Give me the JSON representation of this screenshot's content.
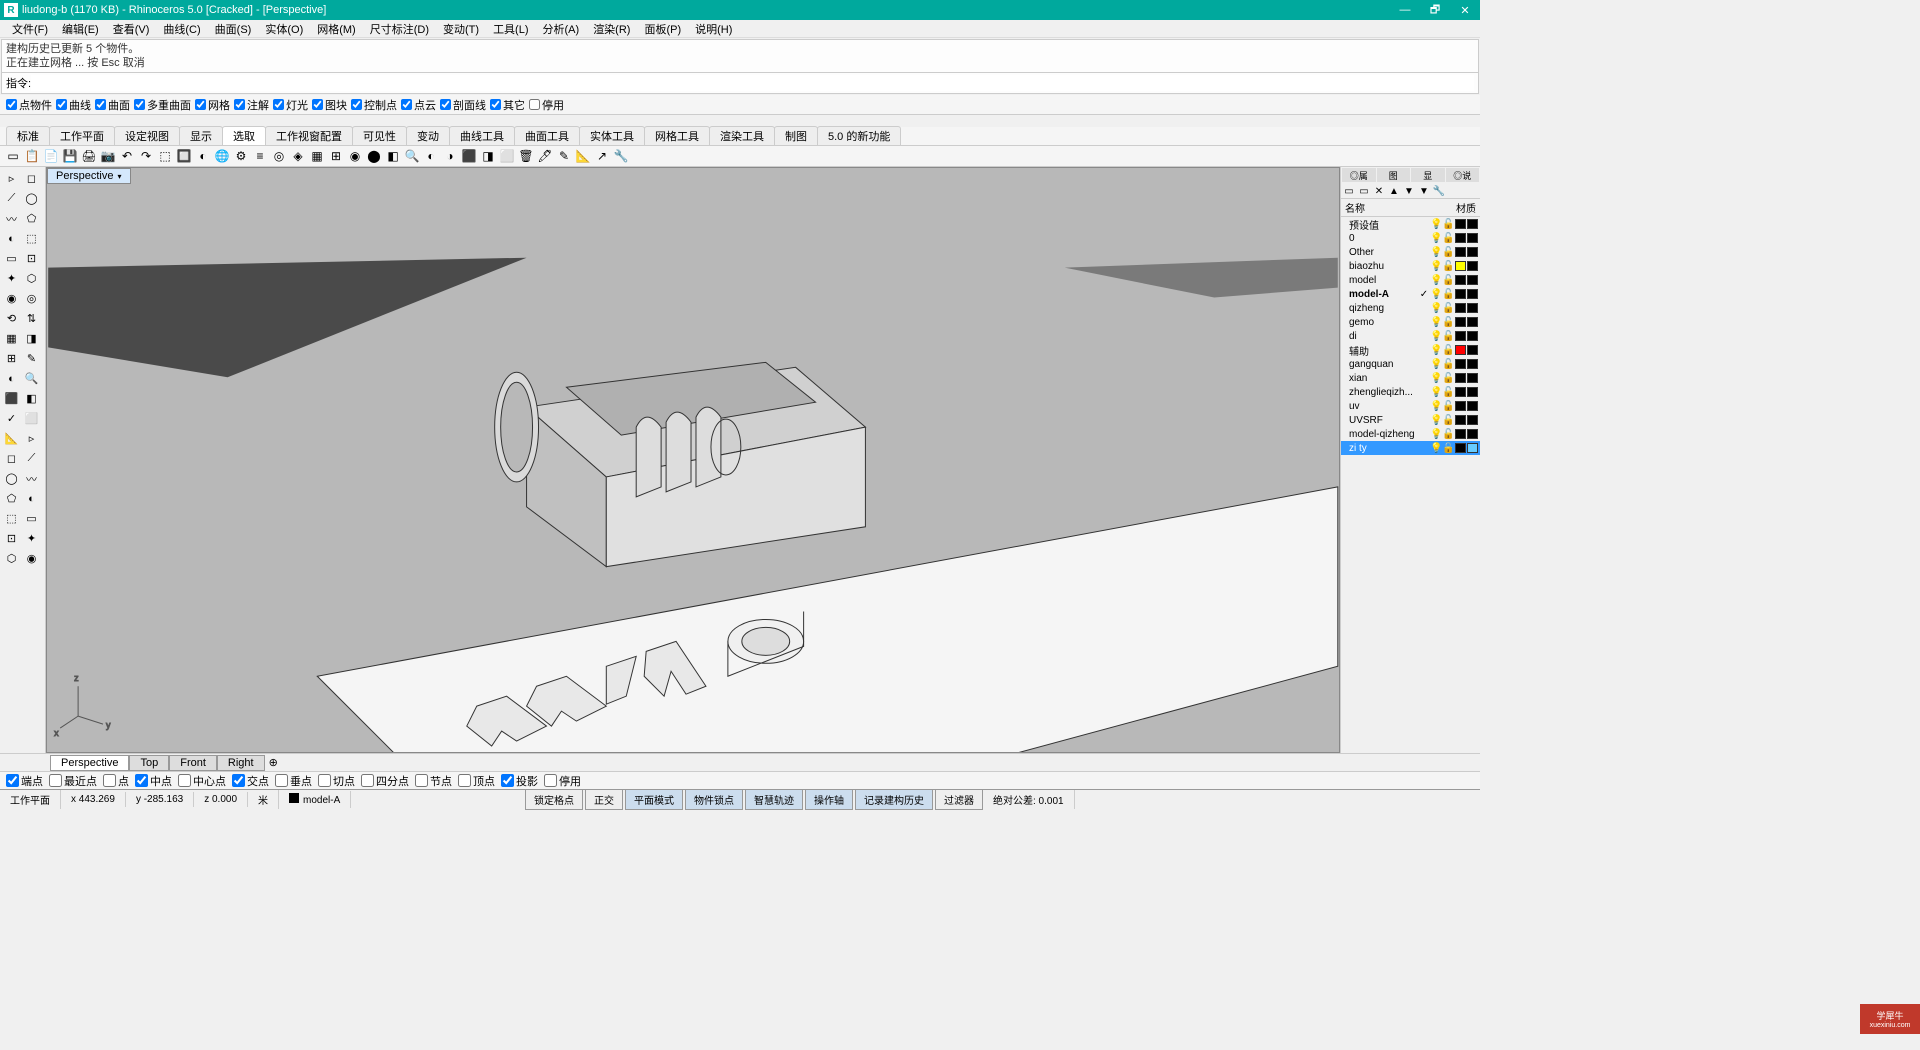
{
  "title": "liudong-b (1170 KB) - Rhinoceros 5.0 [Cracked] - [Perspective]",
  "menu": [
    "文件(F)",
    "编辑(E)",
    "查看(V)",
    "曲线(C)",
    "曲面(S)",
    "实体(O)",
    "网格(M)",
    "尺寸标注(D)",
    "变动(T)",
    "工具(L)",
    "分析(A)",
    "渲染(R)",
    "面板(P)",
    "说明(H)"
  ],
  "cmd_history": [
    "建构历史已更新 5 个物件。",
    "正在建立网格 ... 按 Esc 取消"
  ],
  "cmd_label": "指令:",
  "filters": [
    {
      "label": "点物件",
      "c": true
    },
    {
      "label": "曲线",
      "c": true
    },
    {
      "label": "曲面",
      "c": true
    },
    {
      "label": "多重曲面",
      "c": true
    },
    {
      "label": "网格",
      "c": true
    },
    {
      "label": "注解",
      "c": true
    },
    {
      "label": "灯光",
      "c": true
    },
    {
      "label": "图块",
      "c": true
    },
    {
      "label": "控制点",
      "c": true
    },
    {
      "label": "点云",
      "c": true
    },
    {
      "label": "剖面线",
      "c": true
    },
    {
      "label": "其它",
      "c": true
    },
    {
      "label": "停用",
      "c": false
    }
  ],
  "tabs": [
    "标准",
    "工作平面",
    "设定视图",
    "显示",
    "选取",
    "工作视窗配置",
    "可见性",
    "变动",
    "曲线工具",
    "曲面工具",
    "实体工具",
    "网格工具",
    "渲染工具",
    "制图",
    "5.0 的新功能"
  ],
  "active_tab": 4,
  "viewport_label": "Perspective",
  "panel_tabs": [
    "◎属",
    "图",
    "显",
    "◎说"
  ],
  "layer_hdr": {
    "name": "名称",
    "mat": "材质"
  },
  "layers": [
    {
      "n": "预设值",
      "sw": "#000"
    },
    {
      "n": "0",
      "sw": "#000"
    },
    {
      "n": "Other",
      "sw": "#000"
    },
    {
      "n": "biaozhu",
      "sw": "#ff0",
      "b": "#0af"
    },
    {
      "n": "model",
      "sw": "#000"
    },
    {
      "n": "model-A",
      "sw": "#000",
      "bold": true,
      "chk": true
    },
    {
      "n": "qizheng",
      "sw": "#000"
    },
    {
      "n": "gemo",
      "sw": "#000"
    },
    {
      "n": "di",
      "sw": "#000"
    },
    {
      "n": "辅助",
      "sw": "#f00"
    },
    {
      "n": "gangquan",
      "sw": "#000"
    },
    {
      "n": "xian",
      "sw": "#000"
    },
    {
      "n": "zhenglieqizh...",
      "sw": "#000"
    },
    {
      "n": "uv",
      "sw": "#000"
    },
    {
      "n": "UVSRF",
      "sw": "#000"
    },
    {
      "n": "model-qizheng",
      "sw": "#000"
    },
    {
      "n": "zi ty",
      "sw": "#000",
      "sel": true,
      "b2": "#6cf"
    }
  ],
  "viewtabs": [
    "Perspective",
    "Top",
    "Front",
    "Right"
  ],
  "osnaps": [
    {
      "l": "端点",
      "c": true
    },
    {
      "l": "最近点",
      "c": false
    },
    {
      "l": "点",
      "c": false
    },
    {
      "l": "中点",
      "c": true
    },
    {
      "l": "中心点",
      "c": false
    },
    {
      "l": "交点",
      "c": true
    },
    {
      "l": "垂点",
      "c": false
    },
    {
      "l": "切点",
      "c": false
    },
    {
      "l": "四分点",
      "c": false
    },
    {
      "l": "节点",
      "c": false
    },
    {
      "l": "顶点",
      "c": false
    },
    {
      "l": "投影",
      "c": true
    },
    {
      "l": "停用",
      "c": false
    }
  ],
  "status": {
    "cplane": "工作平面",
    "x": "x 443.269",
    "y": "y -285.163",
    "z": "z 0.000",
    "unit": "米",
    "layer": "model-A",
    "btns": [
      "锁定格点",
      "正交",
      "平面模式",
      "物件锁点",
      "智慧轨迹",
      "操作轴",
      "记录建构历史",
      "过滤器"
    ],
    "tol": "绝对公差: 0.001"
  },
  "watermark": {
    "l1": "学犀牛",
    "l2": "xuexiniu.com"
  }
}
